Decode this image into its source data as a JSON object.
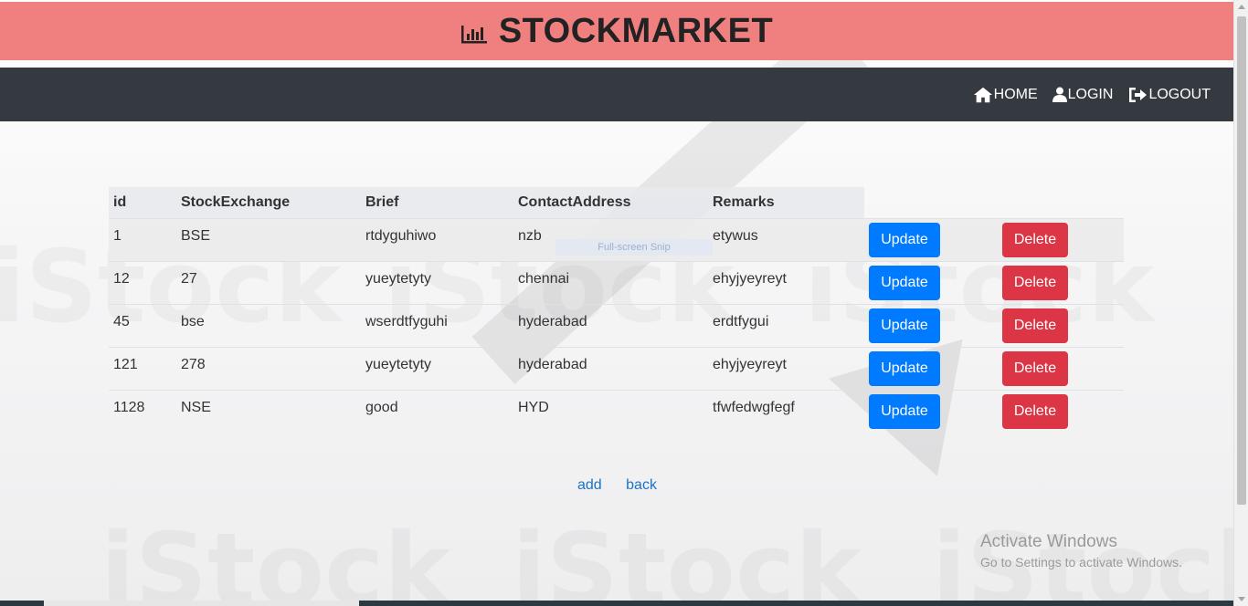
{
  "brand": {
    "title": "STOCKMARKET",
    "icon": "bar-chart-icon",
    "background": "#f08080"
  },
  "navbar": {
    "background": "#343a40",
    "links": [
      {
        "label": "HOME",
        "icon": "home-icon"
      },
      {
        "label": "LOGIN",
        "icon": "user-icon"
      },
      {
        "label": "LOGOUT",
        "icon": "sign-out-icon"
      }
    ]
  },
  "table": {
    "headers": [
      "id",
      "StockExchange",
      "Brief",
      "ContactAddress",
      "Remarks"
    ],
    "rows": [
      {
        "id": "1",
        "exchange": "BSE",
        "brief": "rtdyguhiwo",
        "address": "nzb",
        "remarks": "etywus"
      },
      {
        "id": "12",
        "exchange": "27",
        "brief": "yueytetyty",
        "address": "chennai",
        "remarks": "ehyjyeyreyt"
      },
      {
        "id": "45",
        "exchange": "bse",
        "brief": "wserdtfyguhi",
        "address": "hyderabad",
        "remarks": "erdtfygui"
      },
      {
        "id": "121",
        "exchange": "278",
        "brief": "yueytetyty",
        "address": "hyderabad",
        "remarks": "ehyjyeyreyt"
      },
      {
        "id": "1128",
        "exchange": "NSE",
        "brief": "good",
        "address": "HYD",
        "remarks": "tfwfedwgfegf"
      }
    ],
    "update_label": "Update",
    "delete_label": "Delete",
    "update_color": "#007bff",
    "delete_color": "#dc3545"
  },
  "links": {
    "add": "add",
    "back": "back"
  },
  "overlay": {
    "snip": "Full-screen Snip",
    "activate_title": "Activate Windows",
    "activate_sub": "Go to Settings to activate Windows."
  }
}
